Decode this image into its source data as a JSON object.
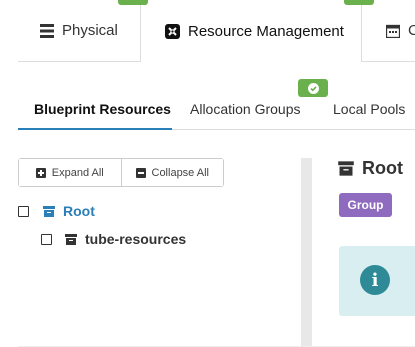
{
  "top_tabs": [
    {
      "label": "Physical",
      "icon": "list-icon"
    },
    {
      "label": "Resource Management",
      "icon": "resource-icon"
    },
    {
      "label": "C",
      "icon": "calendar-icon"
    }
  ],
  "sub_tabs": [
    {
      "label": "Blueprint Resources",
      "active": true
    },
    {
      "label": "Allocation Groups",
      "active": false
    },
    {
      "label": "Local Pools",
      "active": false
    }
  ],
  "buttons": {
    "expand_all": "Expand All",
    "collapse_all": "Collapse All"
  },
  "tree": {
    "root": {
      "label": "Root",
      "color": "#2a7fb8"
    },
    "child": {
      "label": "tube-resources"
    }
  },
  "detail": {
    "title": "Root",
    "badge": "Group"
  },
  "colors": {
    "accent": "#2a7fb8",
    "success": "#6ab04c",
    "group_badge": "#8e6bbf",
    "info_bg": "#d9eef0",
    "info_icon": "#2e8a97"
  }
}
